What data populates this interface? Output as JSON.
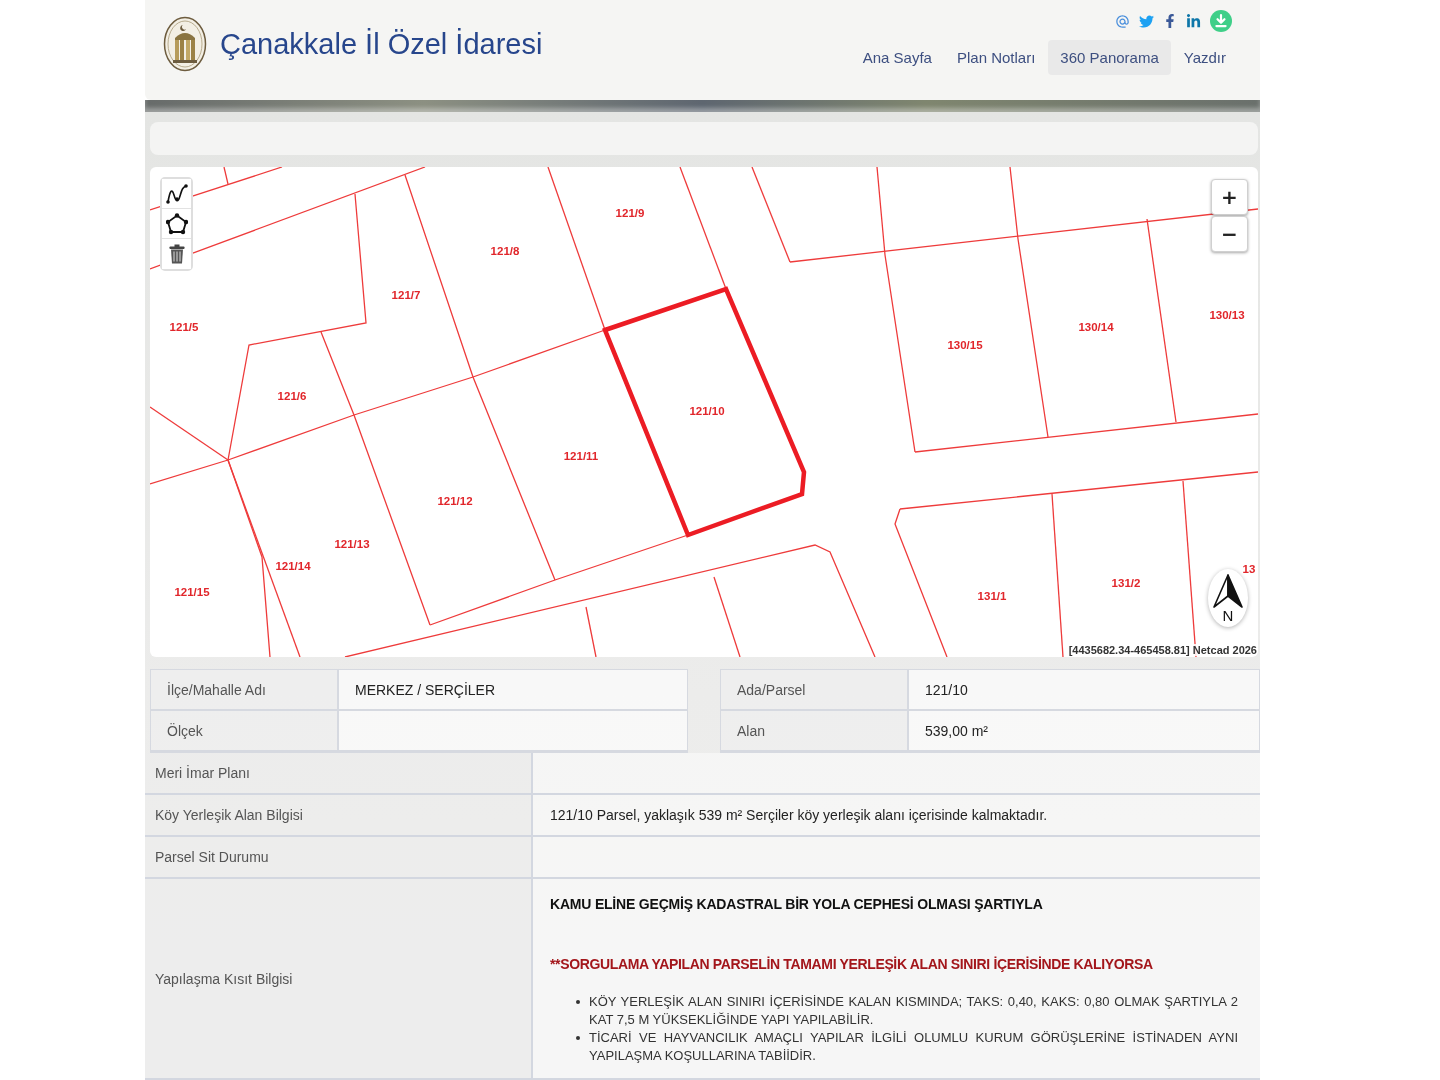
{
  "header": {
    "title": "Çanakkale İl Özel İdaresi",
    "social_links": [
      {
        "kind": "email"
      },
      {
        "kind": "twitter"
      },
      {
        "kind": "facebook"
      },
      {
        "kind": "linkedin"
      },
      {
        "kind": "download"
      }
    ],
    "nav": [
      {
        "label": "Ana Sayfa",
        "selected": false
      },
      {
        "label": "Plan Notları",
        "selected": false
      },
      {
        "label": "360 Panorama",
        "selected": true
      },
      {
        "label": "Yazdır",
        "selected": false
      }
    ]
  },
  "map": {
    "tools": [
      {
        "kind": "line"
      },
      {
        "kind": "polygon"
      },
      {
        "kind": "delete"
      }
    ],
    "zoom_controls": [
      {
        "label": "+"
      },
      {
        "label": "−"
      }
    ],
    "parcels": [
      {
        "label": "121/5",
        "selected": false
      },
      {
        "label": "121/6",
        "selected": false
      },
      {
        "label": "121/7",
        "selected": false
      },
      {
        "label": "121/8",
        "selected": false
      },
      {
        "label": "121/9",
        "selected": false
      },
      {
        "label": "121/10",
        "selected": true
      },
      {
        "label": "121/11",
        "selected": false
      },
      {
        "label": "121/12",
        "selected": false
      },
      {
        "label": "121/13",
        "selected": false
      },
      {
        "label": "121/14",
        "selected": false
      },
      {
        "label": "121/15",
        "selected": false
      },
      {
        "label": "130/15",
        "selected": false
      },
      {
        "label": "130/14",
        "selected": false
      },
      {
        "label": "130/13",
        "selected": false
      },
      {
        "label": "131/1",
        "selected": false
      },
      {
        "label": "131/2",
        "selected": false
      },
      {
        "label": "13",
        "selected": false
      }
    ],
    "north_arrow": {
      "label": "N"
    },
    "coordinates": "[4435682.34-465458.81] Netcad 2026"
  },
  "summary_left": [
    {
      "label": "İlçe/Mahalle Adı",
      "value": "MERKEZ / SERÇİLER"
    },
    {
      "label": "Ölçek"
    }
  ],
  "summary_right": [
    {
      "label": "Ada/Parsel",
      "value": "121/10"
    },
    {
      "label": "Alan",
      "value": "539,00 m²"
    }
  ],
  "details": [
    {
      "kind": "text",
      "label": "Meri İmar Planı"
    },
    {
      "kind": "text",
      "label": "Köy Yerleşik Alan Bilgisi",
      "value": "121/10 Parsel, yaklaşık 539 m² Serçiler köy yerleşik alanı içerisinde kalmaktadır."
    },
    {
      "kind": "text",
      "label": "Parsel Sit Durumu"
    },
    {
      "kind": "rules",
      "label": "Yapılaşma Kısıt Bilgisi",
      "heading": "KAMU ELİNE GEÇMİŞ KADASTRAL BİR YOLA CEPHESİ OLMASI ŞARTIYLA",
      "warning": "**SORGULAMA YAPILAN PARSELİN TAMAMI YERLEŞİK ALAN SINIRI İÇERİSİNDE KALIYORSA",
      "bullets": [
        "KÖY YERLEŞİK ALAN SINIRI İÇERİSİNDE KALAN KISMINDA; TAKS: 0,40, KAKS: 0,80 OLMAK ŞARTIYLA 2 KAT 7,5 M YÜKSEKLİĞİNDE YAPI YAPILABİLİR.",
        "TİCARİ VE HAYVANCILIK AMAÇLI YAPILAR İLGİLİ OLUMLU KURUM GÖRÜŞLERİNE İSTİNADEN AYNI YAPILAŞMA KOŞULLARINA TABİİDİR."
      ]
    }
  ]
}
